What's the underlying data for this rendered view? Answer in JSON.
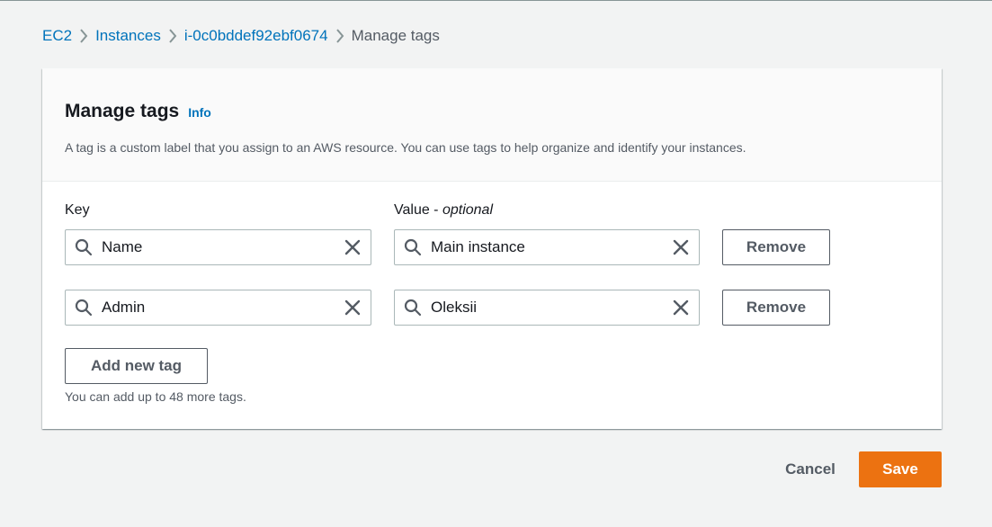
{
  "breadcrumb": {
    "items": [
      {
        "label": "EC2"
      },
      {
        "label": "Instances"
      },
      {
        "label": "i-0c0bddef92ebf0674"
      }
    ],
    "current": "Manage tags"
  },
  "panel": {
    "title": "Manage tags",
    "info_label": "Info",
    "description": "A tag is a custom label that you assign to an AWS resource. You can use tags to help organize and identify your instances."
  },
  "columns": {
    "key_label": "Key",
    "value_label": "Value - ",
    "value_optional": "optional"
  },
  "tags": [
    {
      "key": "Name",
      "value": "Main instance",
      "remove_label": "Remove"
    },
    {
      "key": "Admin",
      "value": "Oleksii",
      "remove_label": "Remove"
    }
  ],
  "add_tag_label": "Add new tag",
  "hint": "You can add up to 48 more tags.",
  "footer": {
    "cancel_label": "Cancel",
    "save_label": "Save"
  },
  "colors": {
    "link": "#0073bb",
    "primary": "#ec7211",
    "background": "#f2f3f3"
  },
  "icons": {
    "separator": "chevron-right-icon",
    "search": "search-icon",
    "clear": "close-icon"
  }
}
